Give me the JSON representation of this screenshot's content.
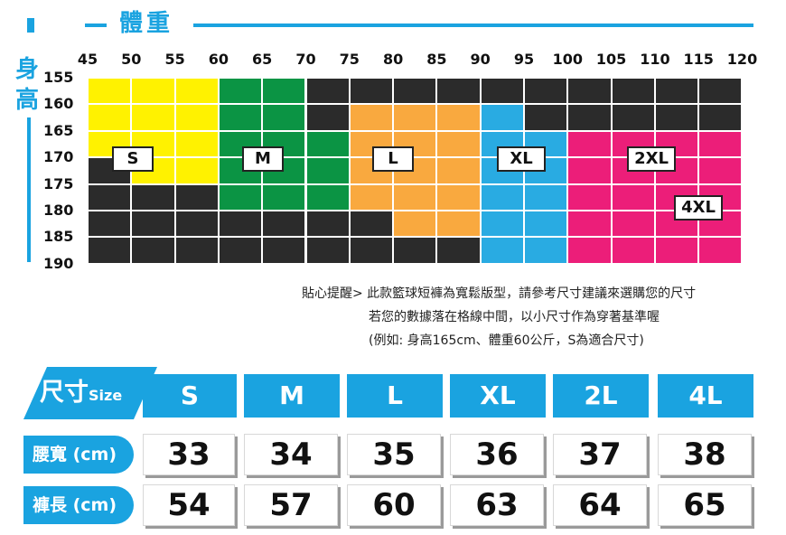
{
  "weight_title": "體重",
  "height_title": [
    "身",
    "高"
  ],
  "weights": [
    "45",
    "50",
    "55",
    "60",
    "65",
    "70",
    "75",
    "80",
    "85",
    "90",
    "95",
    "100",
    "105",
    "110",
    "115",
    "120"
  ],
  "heights": [
    "155",
    "160",
    "165",
    "170",
    "175",
    "180",
    "185",
    "190"
  ],
  "colors": {
    "S": "#fff200",
    "M": "#0b9444",
    "L": "#f9a93f",
    "XL": "#29abe2",
    "2XL": "#ec1e79",
    "4XL": "#ec1e79",
    "none": "#2b2b2b",
    "accent": "#1aa3e0"
  },
  "grid": [
    [
      "S",
      "S",
      "S",
      "M",
      "M",
      "none",
      "none",
      "none",
      "none",
      "none",
      "none",
      "none",
      "none",
      "none",
      "none"
    ],
    [
      "S",
      "S",
      "S",
      "M",
      "M",
      "none",
      "L",
      "L",
      "L",
      "XL",
      "none",
      "none",
      "none",
      "none",
      "none"
    ],
    [
      "S",
      "S",
      "S",
      "M",
      "M",
      "M",
      "L",
      "L",
      "L",
      "XL",
      "XL",
      "2XL",
      "2XL",
      "2XL",
      "2XL"
    ],
    [
      "none",
      "S",
      "S",
      "M",
      "M",
      "M",
      "L",
      "L",
      "L",
      "XL",
      "XL",
      "2XL",
      "2XL",
      "2XL",
      "2XL"
    ],
    [
      "none",
      "none",
      "none",
      "M",
      "M",
      "M",
      "L",
      "L",
      "L",
      "XL",
      "XL",
      "2XL",
      "2XL",
      "2XL",
      "2XL"
    ],
    [
      "none",
      "none",
      "none",
      "none",
      "none",
      "none",
      "none",
      "L",
      "L",
      "XL",
      "XL",
      "2XL",
      "2XL",
      "2XL",
      "2XL"
    ],
    [
      "none",
      "none",
      "none",
      "none",
      "none",
      "none",
      "none",
      "none",
      "none",
      "XL",
      "XL",
      "2XL",
      "2XL",
      "2XL",
      "2XL"
    ]
  ],
  "size_tags": [
    "S",
    "M",
    "L",
    "XL",
    "2XL",
    "4XL"
  ],
  "notes": [
    "貼心提醒> 此款籃球短褲為寬鬆版型，請參考尺寸建議來選購您的尺寸",
    "若您的數據落在格線中間，以小尺寸作為穿著基準喔",
    "(例如: 身高165cm、體重60公斤，S為適合尺寸)"
  ],
  "table": {
    "header_label": "尺寸",
    "header_sub": "Size",
    "sizes": [
      "S",
      "M",
      "L",
      "XL",
      "2L",
      "4L"
    ],
    "rows": [
      {
        "label": "腰寬 (cm)",
        "values": [
          "33",
          "34",
          "35",
          "36",
          "37",
          "38"
        ]
      },
      {
        "label": "褲長 (cm)",
        "values": [
          "54",
          "57",
          "60",
          "63",
          "64",
          "65"
        ]
      }
    ]
  }
}
